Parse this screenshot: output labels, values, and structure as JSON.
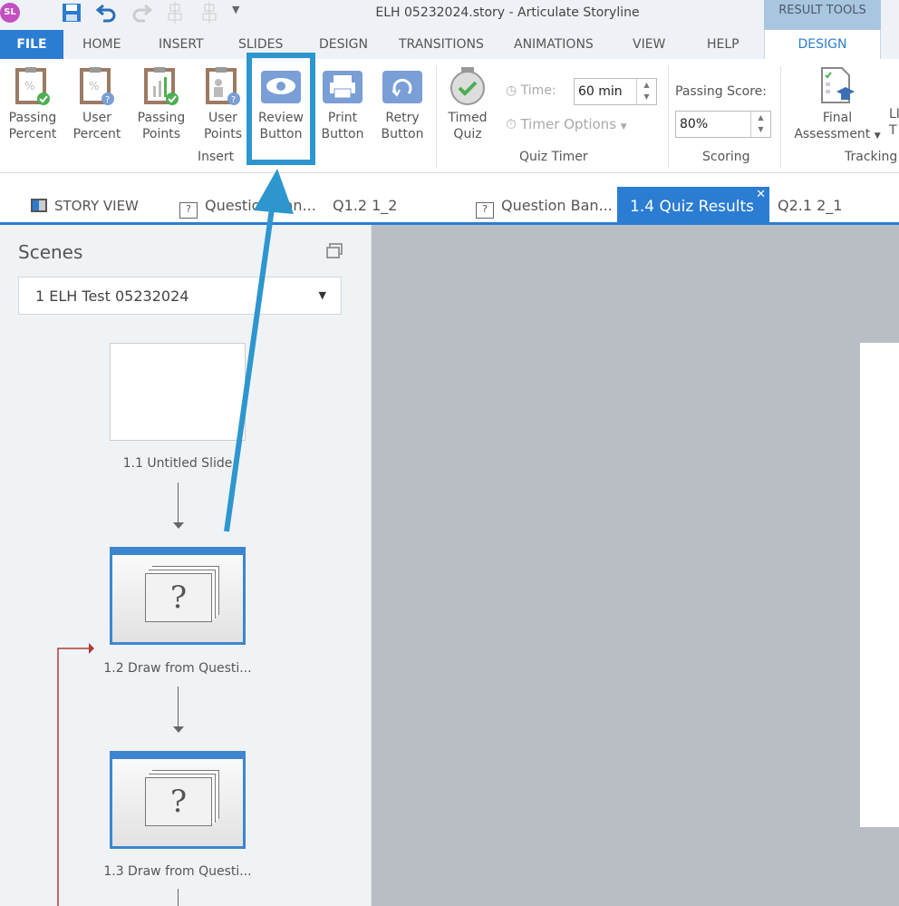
{
  "titlebar": {
    "title": "ELH 05232024.story -  Articulate Storyline",
    "context_group": "RESULT TOOLS",
    "logo": "SL"
  },
  "menu_tabs": [
    "FILE",
    "HOME",
    "INSERT",
    "SLIDES",
    "DESIGN",
    "TRANSITIONS",
    "ANIMATIONS",
    "VIEW",
    "HELP",
    "DESIGN"
  ],
  "ribbon": {
    "insert_buttons": [
      {
        "line1": "Passing",
        "line2": "Percent"
      },
      {
        "line1": "User",
        "line2": "Percent"
      },
      {
        "line1": "Passing",
        "line2": "Points"
      },
      {
        "line1": "User",
        "line2": "Points"
      },
      {
        "line1": "Review",
        "line2": "Button"
      },
      {
        "line1": "Print",
        "line2": "Button"
      },
      {
        "line1": "Retry",
        "line2": "Button"
      }
    ],
    "insert_group": "Insert",
    "timed_quiz": {
      "line1": "Timed",
      "line2": "Quiz"
    },
    "time_label": "Time:",
    "time_value": "60 min",
    "timer_options": "Timer Options",
    "quiz_timer_group": "Quiz Timer",
    "passing_score_label": "Passing Score:",
    "passing_score_value": "80%",
    "scoring_group": "Scoring",
    "final_assessment": {
      "line1": "Final",
      "line2": "Assessment"
    },
    "clipped_button": {
      "line1": "LI",
      "line2": "T"
    },
    "tracking_group": "Tracking"
  },
  "doc_tabs": {
    "story_view": "STORY VIEW",
    "tabs": [
      "Question Ban...",
      "Q1.2 1_2",
      "Question Ban...",
      "1.4 Quiz Results",
      "Q2.1 2_1"
    ],
    "active_index": 3
  },
  "scenes": {
    "title": "Scenes",
    "selected_scene": "1 ELH Test 05232024",
    "slides": [
      "1.1 Untitled Slide",
      "1.2 Draw from Questi...",
      "1.3 Draw from Questi..."
    ]
  },
  "colors": {
    "accent": "#2b7cd3",
    "annotation": "#2e96cf",
    "link_line": "#b03a3a"
  }
}
